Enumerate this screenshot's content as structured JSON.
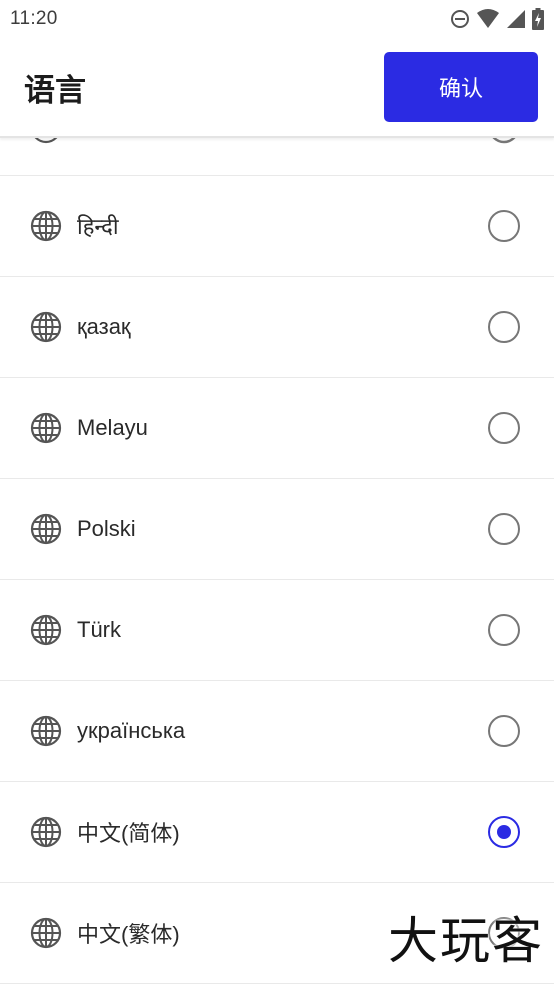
{
  "status_bar": {
    "time": "11:20",
    "icons": [
      "do-not-disturb-icon",
      "wifi-icon",
      "signal-icon",
      "battery-charging-icon"
    ]
  },
  "header": {
    "title": "语言",
    "confirm_label": "确认"
  },
  "languages": [
    {
      "label": "हिन्दी",
      "selected": false
    },
    {
      "label": "қазақ",
      "selected": false
    },
    {
      "label": "Melayu",
      "selected": false
    },
    {
      "label": "Polski",
      "selected": false
    },
    {
      "label": "Türk",
      "selected": false
    },
    {
      "label": "українська",
      "selected": false
    },
    {
      "label": "中文(简体)",
      "selected": true
    },
    {
      "label": "中文(繁体)",
      "selected": false
    }
  ],
  "watermark": "大玩客",
  "colors": {
    "accent": "#2b2be3",
    "radio_unchecked": "#777777",
    "divider": "#e9e9e9"
  }
}
